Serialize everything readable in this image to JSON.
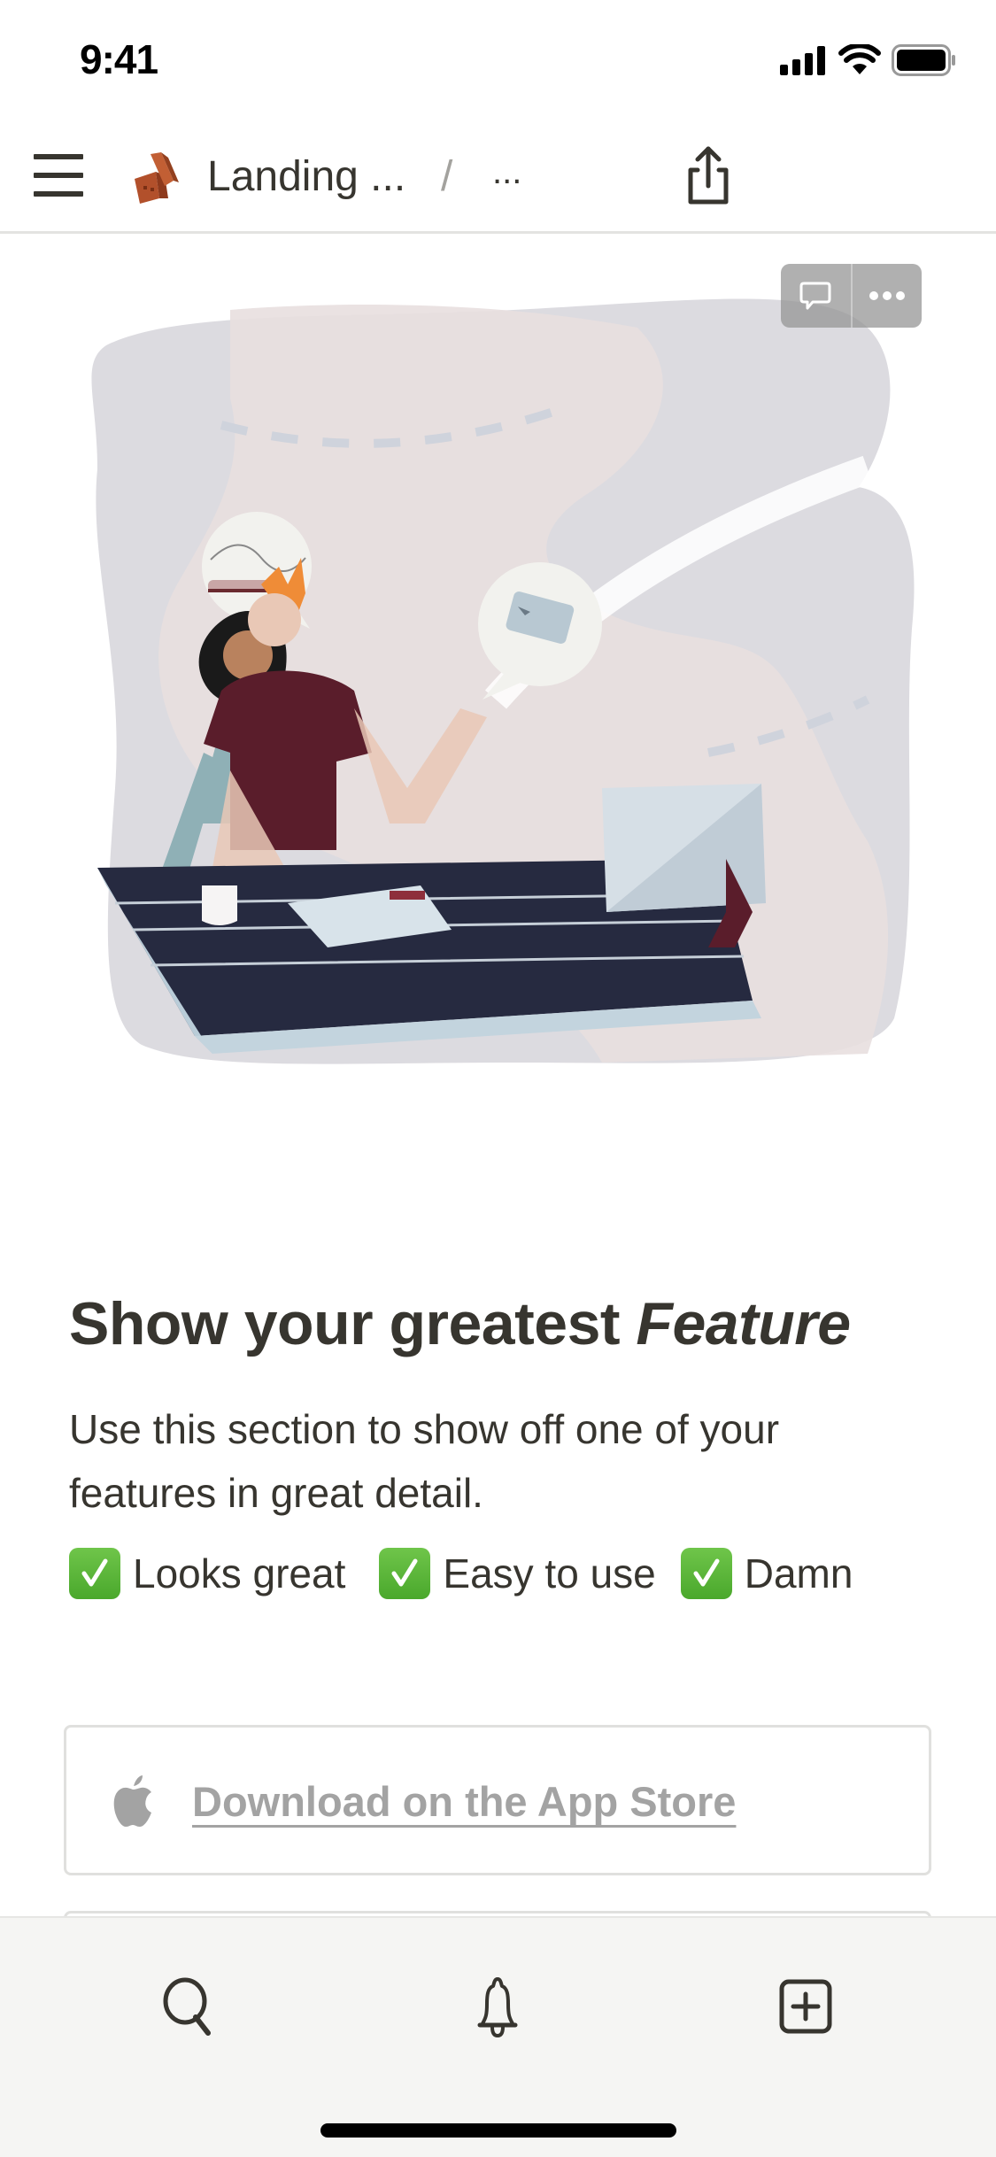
{
  "status_bar": {
    "time": "9:41",
    "icons": [
      "cellular-signal-icon",
      "wifi-icon",
      "battery-icon"
    ]
  },
  "nav": {
    "menu_icon": "hamburger-menu-icon",
    "page_icon": "bricks-emoji",
    "breadcrumb_title": "Landing ...",
    "breadcrumb_separator": "/",
    "breadcrumb_more": "...",
    "share_icon": "share-icon"
  },
  "cover": {
    "description": "Illustration of a couple planning travel at a desk with a map background, train and plane-ticket thought bubbles",
    "actions": [
      "comment-icon",
      "more-icon"
    ]
  },
  "content": {
    "heading_prefix": "Show your greatest ",
    "heading_emphasis": "Feature",
    "paragraph": "Use this section to show off one of your features in great detail.",
    "checks": [
      {
        "icon": "check-box-emoji",
        "label": "Looks great"
      },
      {
        "icon": "check-box-emoji",
        "label": "Easy to use"
      },
      {
        "icon": "check-box-emoji",
        "label": "Damn"
      }
    ],
    "store_button": {
      "icon": "apple-icon",
      "label": "Download on the App Store"
    }
  },
  "tab_bar": {
    "tabs": [
      {
        "icon": "search-icon"
      },
      {
        "icon": "bell-icon"
      },
      {
        "icon": "new-page-icon"
      }
    ]
  },
  "colors": {
    "text": "#37352f",
    "muted": "#a3a3a3",
    "tab_bar_bg": "#f5f5f3",
    "check_green": "#5ab93a"
  }
}
